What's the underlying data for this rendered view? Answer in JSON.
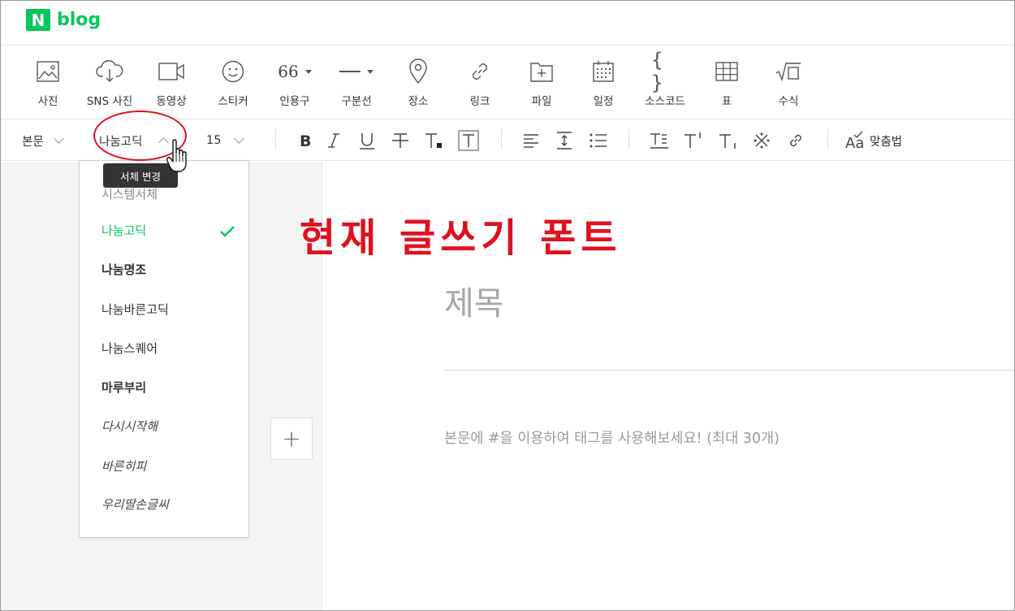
{
  "header": {
    "logo_badge": "N",
    "logo_text": "blog"
  },
  "insert_tools": [
    {
      "label": "사진",
      "icon": "photo-icon"
    },
    {
      "label": "SNS 사진",
      "icon": "cloud-download-icon"
    },
    {
      "label": "동영상",
      "icon": "video-icon"
    },
    {
      "label": "스티커",
      "icon": "smiley-icon"
    },
    {
      "label": "인용구",
      "icon": "quote-icon",
      "glyph": "66"
    },
    {
      "label": "구분선",
      "icon": "divider-icon"
    },
    {
      "label": "장소",
      "icon": "location-pin-icon"
    },
    {
      "label": "링크",
      "icon": "link-icon"
    },
    {
      "label": "파일",
      "icon": "file-add-icon"
    },
    {
      "label": "일정",
      "icon": "calendar-icon"
    },
    {
      "label": "소스코드",
      "icon": "code-braces-icon",
      "glyph": "{ }"
    },
    {
      "label": "표",
      "icon": "table-icon"
    },
    {
      "label": "수식",
      "icon": "formula-icon"
    }
  ],
  "format": {
    "paragraph": "본문",
    "font": "나눔고딕",
    "size": "15",
    "tooltip": "서체 변경",
    "spellcheck": "맞춤법",
    "spellcheck_glyph": "Aa"
  },
  "font_options": [
    "시스템서체",
    "나눔고딕",
    "나눔명조",
    "나눔바른고딕",
    "나눔스퀘어",
    "마루부리",
    "다시시작해",
    "바른히피",
    "우리딸손글씨"
  ],
  "selected_font": "나눔고딕",
  "annotation": "현재 글쓰기 폰트",
  "editor": {
    "title_placeholder": "제목",
    "body_placeholder": "본문에 #을 이용하여 태그를 사용해보세요! (최대 30개)",
    "plus": "+"
  },
  "colors": {
    "brand": "#03c75a",
    "annotation": "#e0101e"
  }
}
